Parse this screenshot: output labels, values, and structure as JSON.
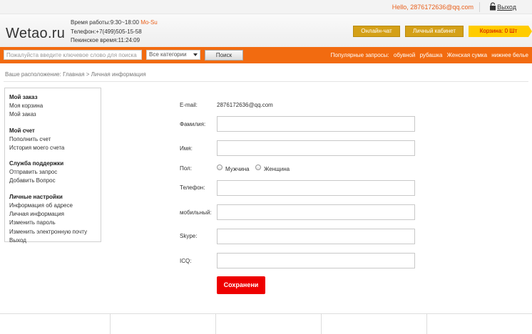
{
  "topbar": {
    "hello": "Hello, 2876172636@qq.com",
    "logout": "Выход"
  },
  "header": {
    "logo": "Wetao.ru",
    "hours_label": "Время работы:",
    "hours_value": "9:30~18:00",
    "hours_days": "Mo-Su",
    "phone": "Телефон:+7(499)505-15-58",
    "beijing_time": "Пекинское время:11:24:09",
    "chat_button": "Онлайн-чат",
    "cabinet_button": "Личный кабинет",
    "cart": "Корзина: 0 Шт"
  },
  "search": {
    "placeholder": "Пожалуйста введите ключевое слово для поиска",
    "category": "Все категории",
    "button": "Поиск",
    "popular_label": "Популярные запросы:",
    "popular": [
      "обувной",
      "рубашка",
      "Женская сумка",
      "нижнее белье"
    ]
  },
  "breadcrumb": "Ваше расположение: Главная > Личная информация",
  "sidebar": {
    "groups": [
      {
        "title": "Мой заказ",
        "items": [
          "Моя корзина",
          "Мой заказ"
        ]
      },
      {
        "title": "Мой счет",
        "items": [
          "Пополнить счет",
          "История моего счета"
        ]
      },
      {
        "title": "Служба поддержки",
        "items": [
          "Отправить запрос",
          "Добавить Вопрос"
        ]
      },
      {
        "title": "Личные настройки",
        "items": [
          "Информация об адресе",
          "Личная информация",
          "Изменить пароль",
          "Изменить электронную почту",
          "Выход"
        ]
      }
    ]
  },
  "form": {
    "email_label": "E-mail:",
    "email_value": "2876172636@qq.com",
    "lastname_label": "Фамилия:",
    "firstname_label": "Имя:",
    "gender_label": "Пол:",
    "gender_male": "Мужчина",
    "gender_female": "Женщина",
    "phone_label": "Телефон:",
    "mobile_label": "мобильный:",
    "skype_label": "Skype:",
    "icq_label": "ICQ:",
    "save_button": "Сохранени"
  },
  "colors": {
    "accent": "#f26b10",
    "save": "#ee0000",
    "header_button": "#d4a017",
    "cart": "#ffcc00"
  }
}
